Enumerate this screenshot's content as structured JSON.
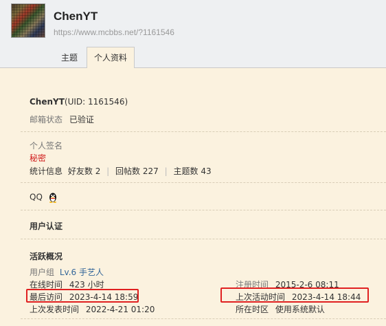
{
  "profile": {
    "username": "ChenYT",
    "url": "https://www.mcbbs.net/?1161546"
  },
  "tabs": [
    {
      "label": "主题"
    },
    {
      "label": "个人资料",
      "active": true
    }
  ],
  "info": {
    "name": "ChenYT",
    "uid_text": "(UID: 1161546)",
    "email_label": "邮箱状态",
    "email_value": "已验证",
    "signature_label": "个人签名",
    "signature_value": "秘密",
    "stats_label": "统计信息",
    "friends_label": "好友数",
    "friends_value": "2",
    "posts_label": "回帖数",
    "posts_value": "227",
    "threads_label": "主题数",
    "threads_value": "43",
    "qq_label": "QQ"
  },
  "auth": {
    "title": "用户认证"
  },
  "activity": {
    "title": "活跃概况",
    "group_label": "用户组",
    "group_value": "Lv.6 手艺人",
    "online_label": "在线时间",
    "online_value": "423 小时",
    "last_visit_label": "最后访问",
    "last_visit_value": "2023-4-14 18:59",
    "last_post_label": "上次发表时间",
    "last_post_value": "2022-4-21 01:20",
    "register_label": "注册时间",
    "register_value": "2015-2-6 08:11",
    "last_active_label": "上次活动时间",
    "last_active_value": "2023-4-14 18:44",
    "timezone_label": "所在时区",
    "timezone_value": "使用系统默认"
  },
  "colors": {
    "highlight_box": "#e02020",
    "background": "#fbf2df",
    "header": "#eef0f2"
  }
}
